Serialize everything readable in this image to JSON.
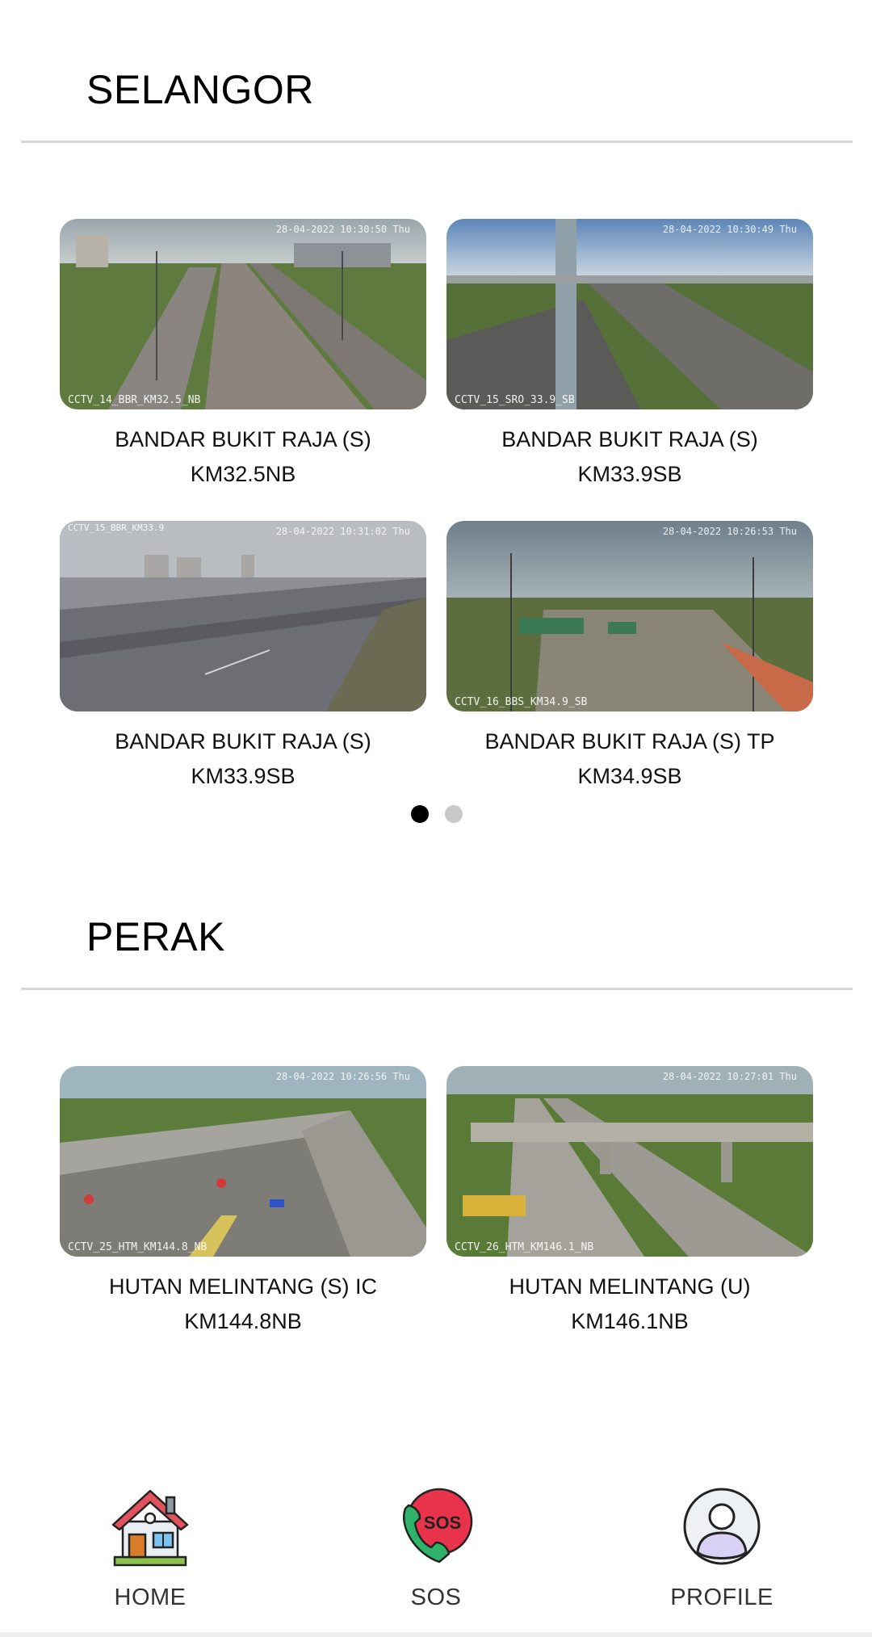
{
  "sections": [
    {
      "title": "SELANGOR",
      "cameras": [
        {
          "name": "BANDAR BUKIT RAJA (S)",
          "km": "KM32.5NB",
          "overlay_id": "CCTV_14_BBR_KM32.5_NB",
          "overlay_time": "28-04-2022 10:30:50 Thu"
        },
        {
          "name": "BANDAR BUKIT RAJA (S)",
          "km": "KM33.9SB",
          "overlay_id": "CCTV_15_SRO_33.9_SB",
          "overlay_time": "28-04-2022 10:30:49 Thu"
        },
        {
          "name": "BANDAR BUKIT RAJA (S)",
          "km": "KM33.9SB",
          "overlay_id": "CCTV_15_BBR_KM33.9",
          "overlay_time": "28-04-2022 10:31:02 Thu"
        },
        {
          "name": "BANDAR BUKIT RAJA (S) TP",
          "km": "KM34.9SB",
          "overlay_id": "CCTV_16_BBS_KM34.9_SB",
          "overlay_time": "28-04-2022 10:26:53 Thu"
        }
      ],
      "pagination": {
        "pages": 2,
        "active": 0
      }
    },
    {
      "title": "PERAK",
      "cameras": [
        {
          "name": "HUTAN MELINTANG (S) IC",
          "km": "KM144.8NB",
          "overlay_id": "CCTV_25_HTM_KM144.8_NB",
          "overlay_time": "28-04-2022 10:26:56 Thu"
        },
        {
          "name": "HUTAN MELINTANG (U)",
          "km": "KM146.1NB",
          "overlay_id": "CCTV_26_HTM_KM146.1_NB",
          "overlay_time": "28-04-2022 10:27:01 Thu"
        }
      ]
    }
  ],
  "nav": {
    "home": {
      "label": "HOME",
      "icon": "home-icon"
    },
    "sos": {
      "label": "SOS",
      "icon": "sos-phone-icon",
      "badge_text": "SOS"
    },
    "profile": {
      "label": "PROFILE",
      "icon": "profile-icon"
    }
  },
  "colors": {
    "divider": "#d8d8d8",
    "dot_active": "#000000",
    "dot_inactive": "#c8c8c8",
    "sos_red": "#e8334a",
    "sos_green": "#2fb36a"
  }
}
